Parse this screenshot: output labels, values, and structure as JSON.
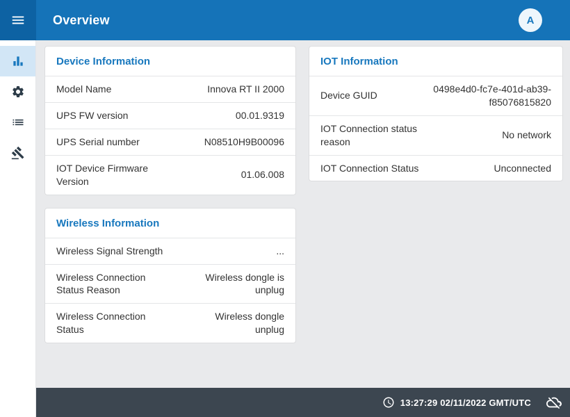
{
  "header": {
    "title": "Overview",
    "avatar_letter": "A"
  },
  "sidebar": {
    "items": [
      {
        "icon": "bar-chart-icon",
        "active": true
      },
      {
        "icon": "gear-icon",
        "active": false
      },
      {
        "icon": "list-icon",
        "active": false
      },
      {
        "icon": "gavel-icon",
        "active": false
      }
    ]
  },
  "cards": {
    "device": {
      "title": "Device Information",
      "rows": [
        {
          "label": "Model Name",
          "value": "Innova RT II 2000"
        },
        {
          "label": "UPS FW version",
          "value": "00.01.9319"
        },
        {
          "label": "UPS Serial number",
          "value": "N08510H9B00096"
        },
        {
          "label": "IOT Device Firmware Version",
          "value": "01.06.008"
        }
      ]
    },
    "iot": {
      "title": "IOT Information",
      "rows": [
        {
          "label": "Device GUID",
          "value": "0498e4d0-fc7e-401d-ab39-f85076815820"
        },
        {
          "label": "IOT Connection status reason",
          "value": "No network"
        },
        {
          "label": "IOT Connection Status",
          "value": "Unconnected"
        }
      ]
    },
    "wireless": {
      "title": "Wireless Information",
      "rows": [
        {
          "label": "Wireless Signal Strength",
          "value": "..."
        },
        {
          "label": "Wireless Connection Status Reason",
          "value": "Wireless dongle is unplug"
        },
        {
          "label": "Wireless Connection Status",
          "value": "Wireless dongle unplug"
        }
      ]
    }
  },
  "statusbar": {
    "datetime": "13:27:29 02/11/2022 GMT/UTC"
  },
  "colors": {
    "header_blue": "#1573b8",
    "menu_blue": "#0d62a3",
    "accent_blue": "#1878be",
    "statusbar_bg": "#3c4650",
    "content_bg": "#e9eaec"
  }
}
